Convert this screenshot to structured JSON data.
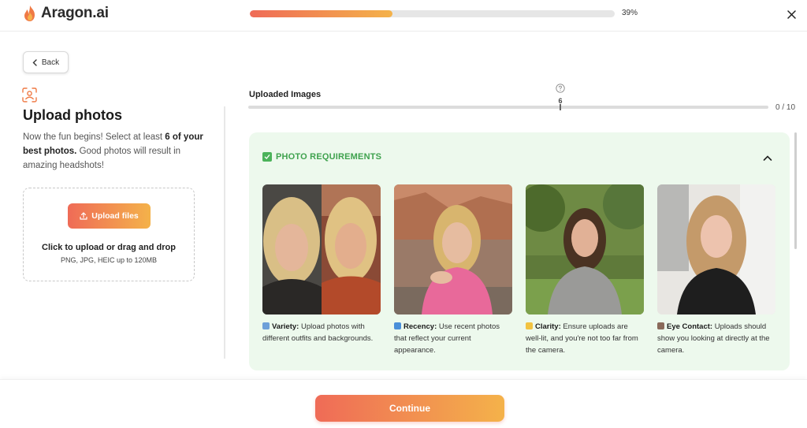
{
  "app": {
    "name": "Aragon.ai",
    "accent_start": "#ef6b57",
    "accent_end": "#f4b24a"
  },
  "progress": {
    "fraction": 0.39,
    "label": "39%"
  },
  "header": {
    "close_icon": "close-icon"
  },
  "nav": {
    "back_label": "Back"
  },
  "upload": {
    "title": "Upload photos",
    "desc_part1": "Now the fun begins! Select at least ",
    "desc_bold": "6 of your best photos.",
    "desc_part2": " Good photos will result in amazing headshots!",
    "button_label": "Upload files",
    "drop_text": "Click to upload or drag and drop",
    "formats": "PNG, JPG, HEIC up to 120MB"
  },
  "uploaded": {
    "label": "Uploaded Images",
    "min_marker": "6",
    "count": "0 / 10",
    "current": 0,
    "min": 6,
    "max": 10
  },
  "requirements": {
    "title": "PHOTO REQUIREMENTS",
    "items": [
      {
        "title": "Variety:",
        "text": " Upload photos with different outfits and backgrounds.",
        "icon": "shirt-icon"
      },
      {
        "title": "Recency:",
        "text": " Use recent photos that reflect your current appearance.",
        "icon": "new-badge-icon"
      },
      {
        "title": "Clarity:",
        "text": " Ensure uploads are well-lit, and you're not too far from the camera.",
        "icon": "sun-icon"
      },
      {
        "title": "Eye Contact:",
        "text": " Uploads should show you looking at directly at the camera.",
        "icon": "eye-icon"
      }
    ]
  },
  "footer": {
    "continue_label": "Continue"
  }
}
